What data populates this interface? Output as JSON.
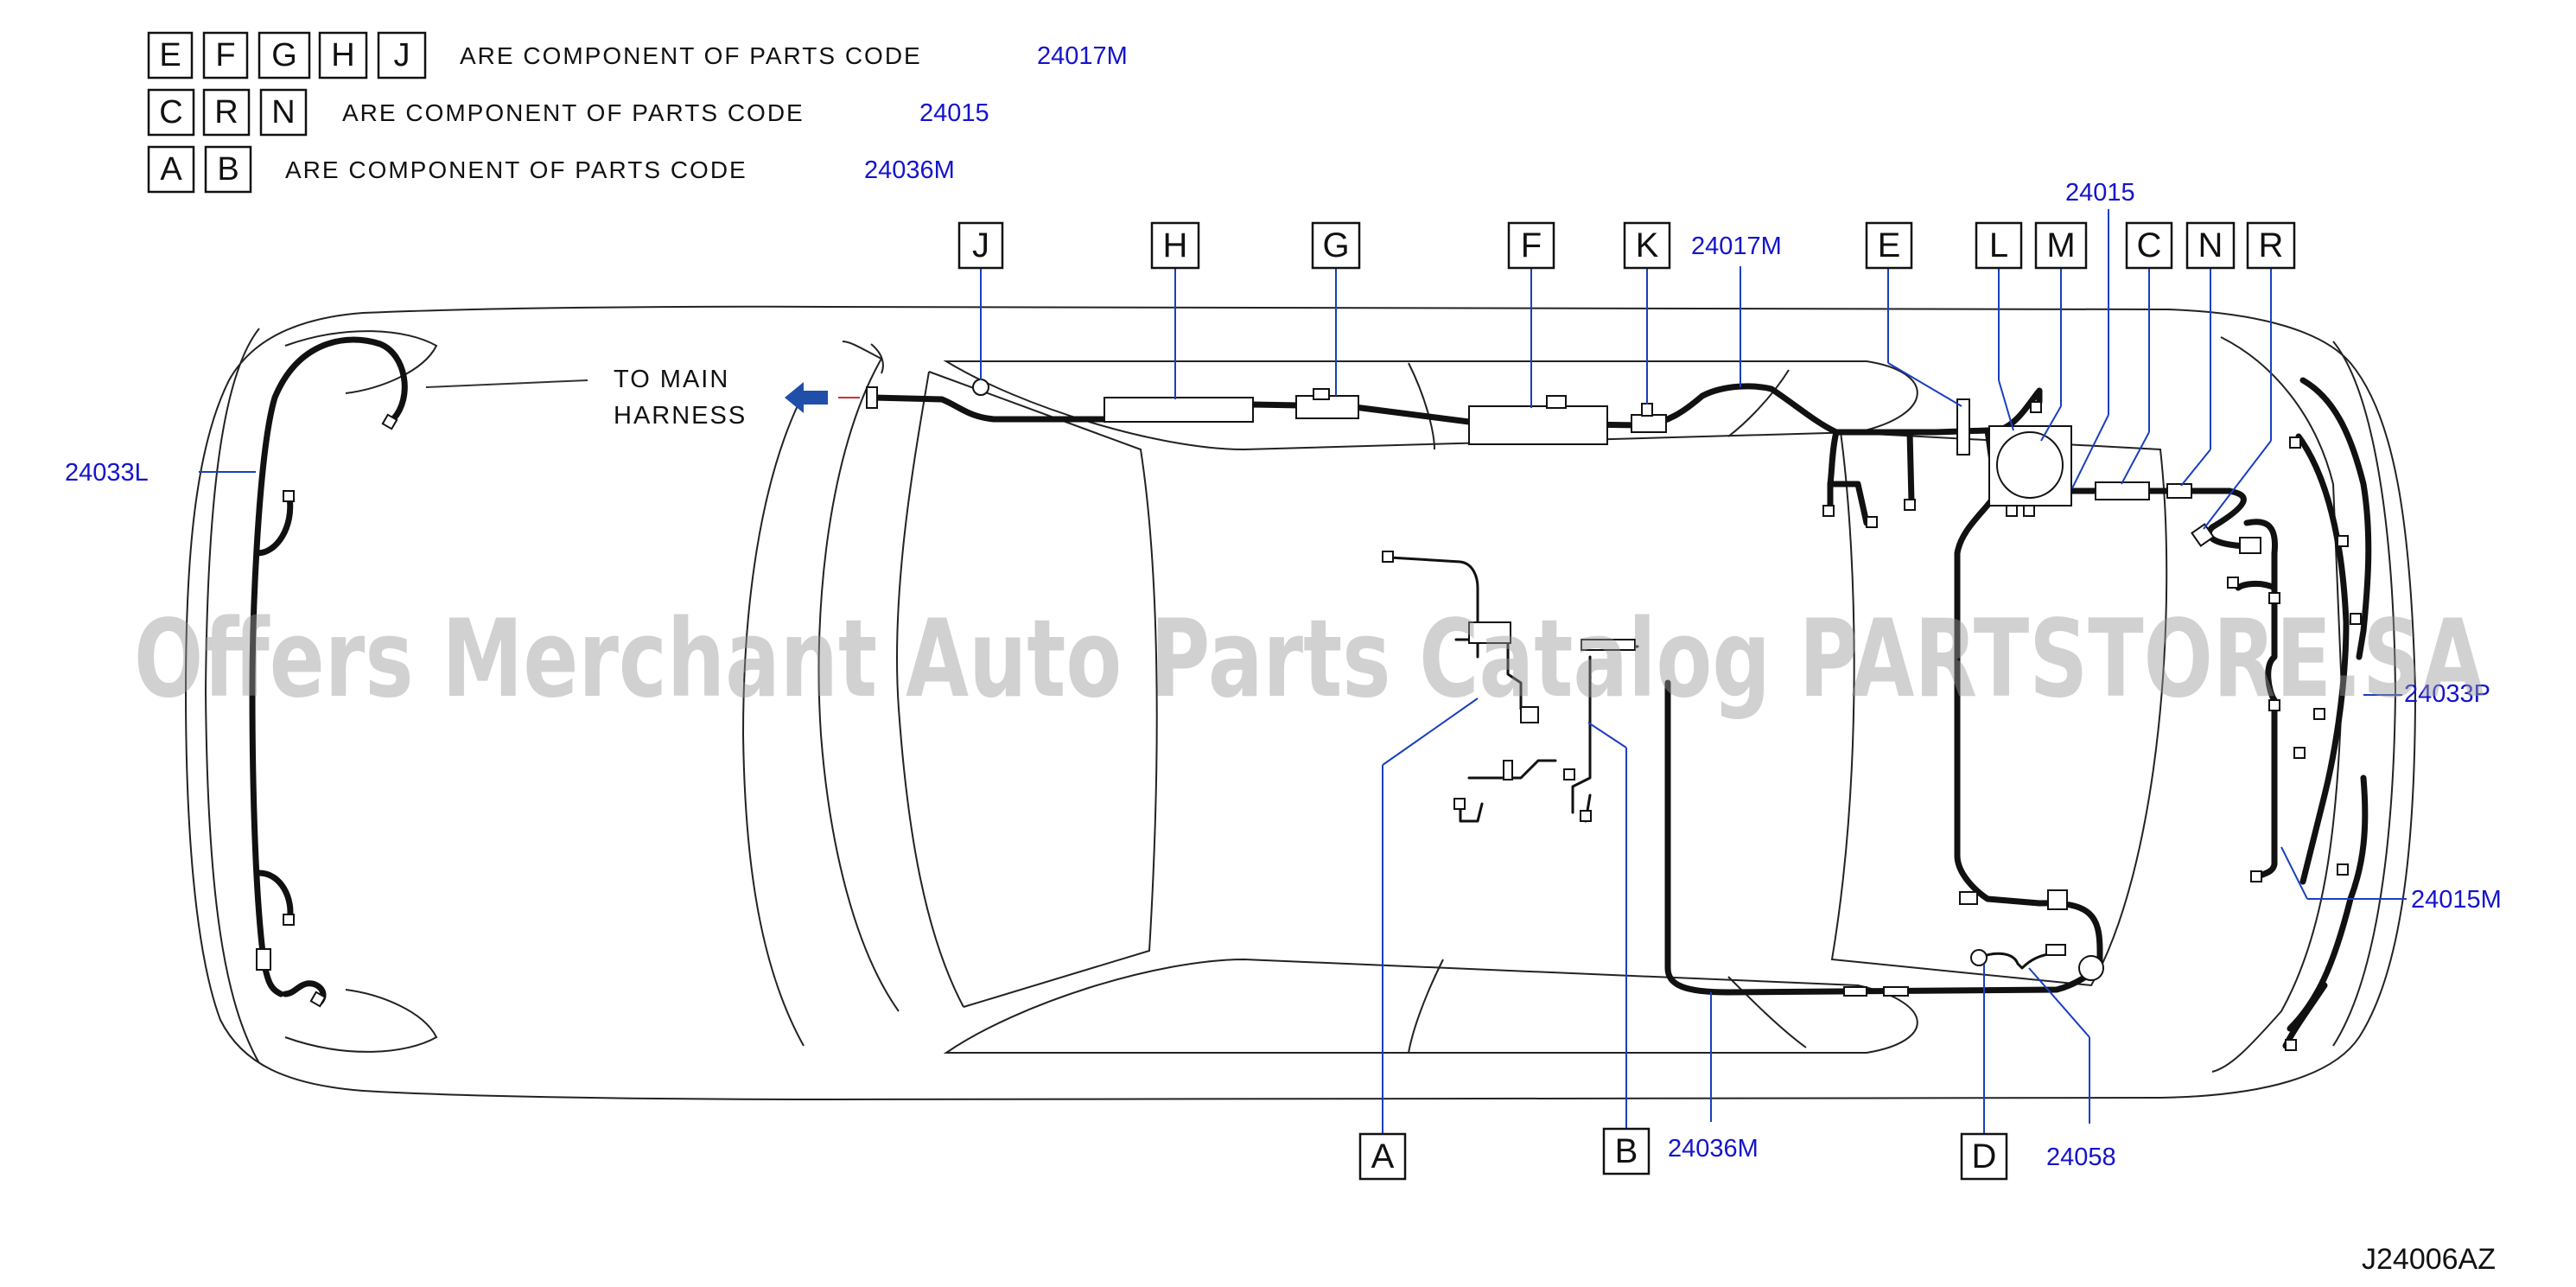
{
  "legend": [
    {
      "letters": [
        "E",
        "F",
        "G",
        "H",
        "J"
      ],
      "text": "ARE COMPONENT OF PARTS CODE",
      "code": "24017M"
    },
    {
      "letters": [
        "C",
        "R",
        "N"
      ],
      "text": "ARE COMPONENT OF PARTS CODE",
      "code": "24015"
    },
    {
      "letters": [
        "A",
        "B"
      ],
      "text": "ARE COMPONENT OF PARTS CODE",
      "code": "24036M"
    }
  ],
  "top_callouts": [
    "J",
    "H",
    "G",
    "F",
    "K",
    "E",
    "L",
    "M",
    "C",
    "N",
    "R"
  ],
  "bottom_callouts": [
    "A",
    "B",
    "D"
  ],
  "part_codes": {
    "k_code": "24017M",
    "top_right": "24015",
    "left": "24033L",
    "right_upper": "24033P",
    "right_lower": "24015M",
    "bottom_mid": "24036M",
    "bottom_right": "24058"
  },
  "note": {
    "line1": "TO MAIN",
    "line2": "HARNESS"
  },
  "figure_id": "J24006AZ",
  "watermark": "Offers Merchant Auto Parts Catalog PARTSTORE.SA",
  "colors": {
    "code_blue": "#1414cc",
    "arrow_blue": "#1f4fa8",
    "leader_blue": "#1a3fbf"
  }
}
